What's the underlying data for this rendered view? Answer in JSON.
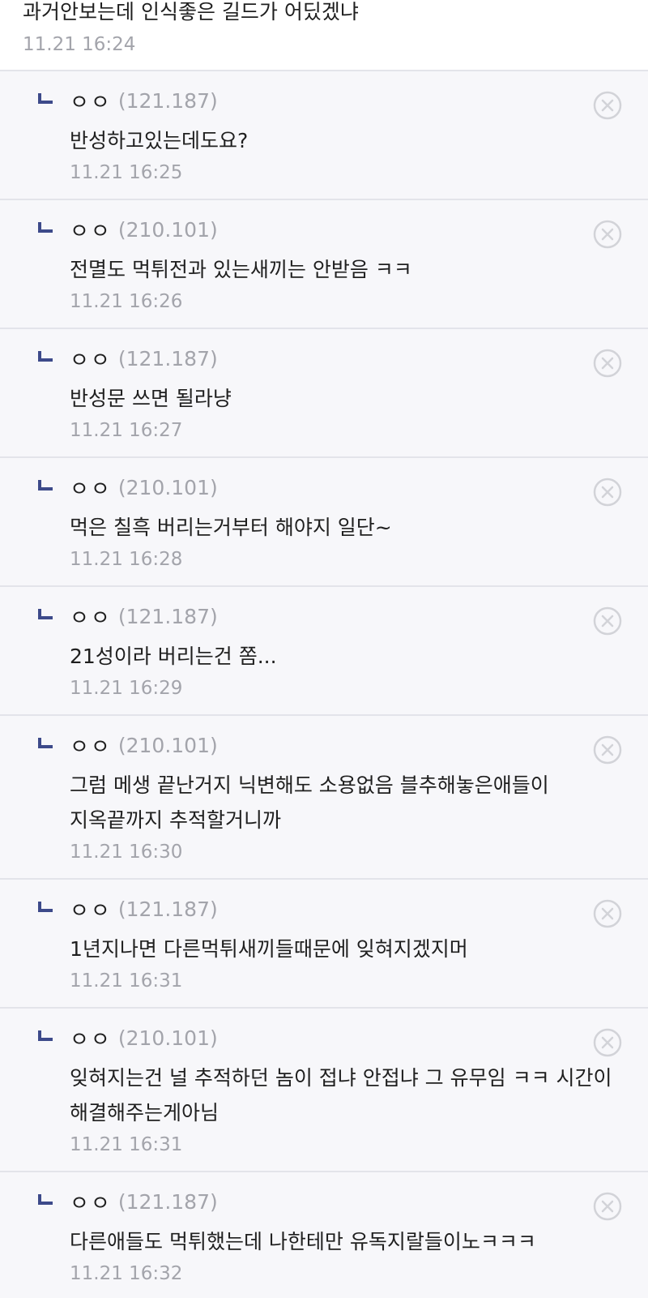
{
  "root_comment": {
    "text": "과거안보는데 인식좋은 길드가 어딨겠냐",
    "time": "11.21 16:24"
  },
  "replies": [
    {
      "name": "ㅇㅇ",
      "ip": "(121.187)",
      "text": "반성하고있는데도요?",
      "time": "11.21 16:25"
    },
    {
      "name": "ㅇㅇ",
      "ip": "(210.101)",
      "text": "전멸도 먹튀전과 있는새끼는 안받음 ㅋㅋ",
      "time": "11.21 16:26"
    },
    {
      "name": "ㅇㅇ",
      "ip": "(121.187)",
      "text": "반성문 쓰면 될라냥",
      "time": "11.21 16:27"
    },
    {
      "name": "ㅇㅇ",
      "ip": "(210.101)",
      "text": "먹은 칠흑 버리는거부터 해야지 일단~",
      "time": "11.21 16:28"
    },
    {
      "name": "ㅇㅇ",
      "ip": "(121.187)",
      "text": "21성이라 버리는건 쫌...",
      "time": "11.21 16:29"
    },
    {
      "name": "ㅇㅇ",
      "ip": "(210.101)",
      "text": "그럼 메생 끝난거지 닉변해도 소용없음 블추해놓은애들이 지옥끝까지 추적할거니까",
      "time": "11.21 16:30"
    },
    {
      "name": "ㅇㅇ",
      "ip": "(121.187)",
      "text": "1년지나면 다른먹튀새끼들때문에 잊혀지겠지머",
      "time": "11.21 16:31"
    },
    {
      "name": "ㅇㅇ",
      "ip": "(210.101)",
      "text": "잊혀지는건 널 추적하던 놈이 접냐 안접냐 그 유무임 ㅋㅋ 시간이 해결해주는게아님",
      "time": "11.21 16:31"
    },
    {
      "name": "ㅇㅇ",
      "ip": "(121.187)",
      "text": "다른애들도 먹튀했는데 나한테만 유독지랄들이노ㅋㅋㅋ",
      "time": "11.21 16:32"
    }
  ],
  "icons": {
    "reply_arrow": "reply-arrow-icon",
    "delete": "close-circle-icon"
  },
  "colors": {
    "reply_arrow": "#3d4a8a",
    "meta_text": "#a3a4ab",
    "reply_background": "#f7f7fa",
    "divider": "#e3e4ea",
    "delete_icon": "#d2d3d8"
  }
}
